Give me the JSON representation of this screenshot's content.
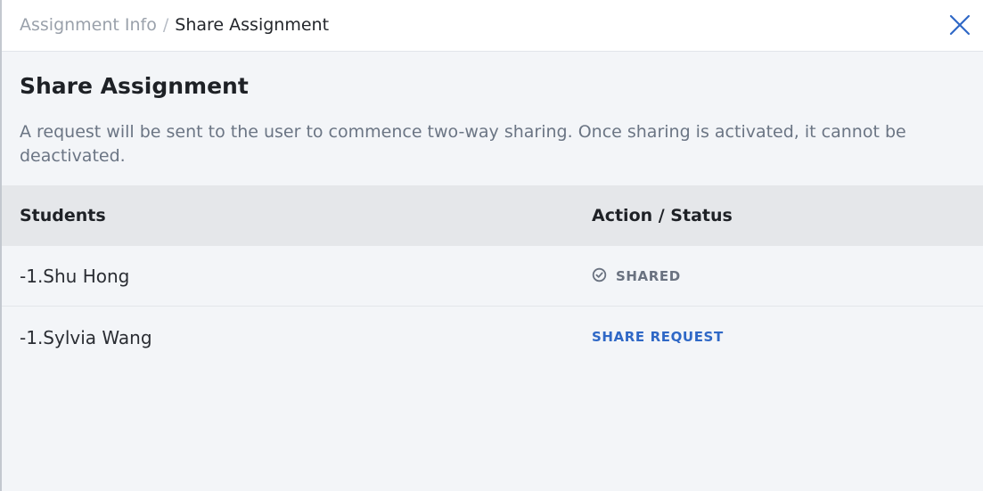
{
  "header": {
    "breadcrumb_parent": "Assignment Info",
    "breadcrumb_separator": "/",
    "breadcrumb_current": "Share Assignment",
    "close_icon": "close-icon"
  },
  "main": {
    "title": "Share Assignment",
    "description": "A request will be sent to the user to commence two-way sharing. Once sharing is activated, it cannot be deactivated."
  },
  "table": {
    "columns": [
      "Students",
      "Action / Status"
    ],
    "rows": [
      {
        "name": "-1.Shu Hong",
        "status": "SHARED",
        "status_icon": "check-circle-icon"
      },
      {
        "name": "-1.Sylvia Wang",
        "action": "SHARE REQUEST"
      }
    ]
  },
  "colors": {
    "accent": "#2f68c6",
    "background": "#f3f5f8",
    "header_bg": "#ffffff",
    "table_header_bg": "#e5e7ea",
    "muted_text": "#6b7584"
  }
}
